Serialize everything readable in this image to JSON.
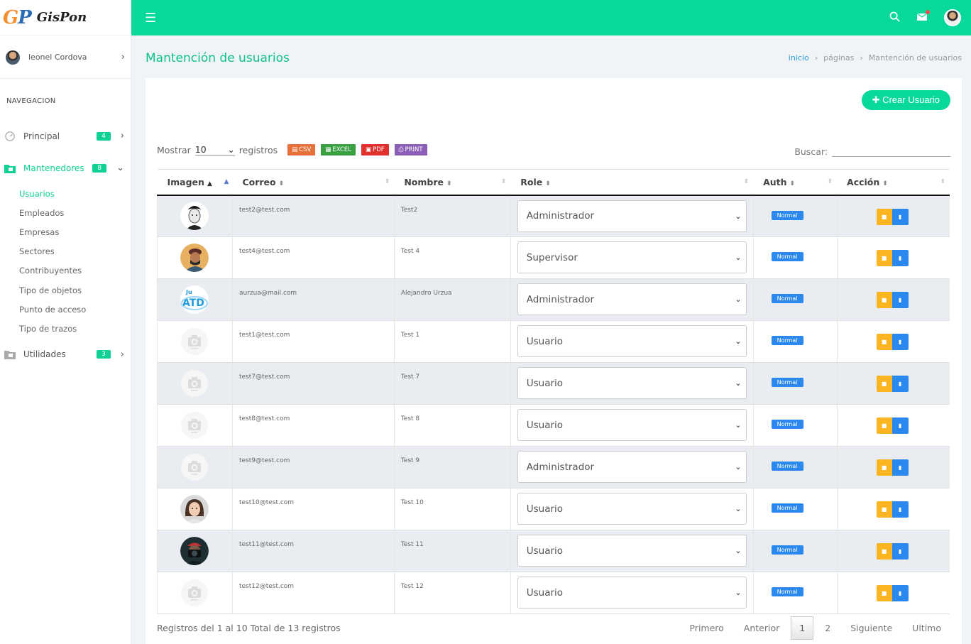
{
  "brand": {
    "logo_letters": "GP",
    "name": "GisPon"
  },
  "user": {
    "name": "leonel Cordova"
  },
  "nav": {
    "section_label": "NAVEGACION",
    "principal": {
      "label": "Principal",
      "badge": "4"
    },
    "mantenedores": {
      "label": "Mantenedores",
      "badge": "8"
    },
    "sub_items": [
      "Usuarios",
      "Empleados",
      "Empresas",
      "Sectores",
      "Contribuyentes",
      "Tipo de objetos",
      "Punto de acceso",
      "Tipo de trazos"
    ],
    "utilidades": {
      "label": "Utilidades",
      "badge": "3"
    }
  },
  "page": {
    "title": "Mantención de usuarios"
  },
  "breadcrumb": {
    "home": "inicio",
    "middle": "páginas",
    "current": "Mantención de usuarios"
  },
  "create_button": "Crear Usuario",
  "controls": {
    "show_label": "Mostrar",
    "show_value": "10",
    "records_label": "registros",
    "search_label": "Buscar:"
  },
  "export_buttons": [
    {
      "label": "CSV",
      "color": "#e8703a"
    },
    {
      "label": "EXCEL",
      "color": "#3aa142"
    },
    {
      "label": "PDF",
      "color": "#e0312e"
    },
    {
      "label": "PRINT",
      "color": "#8c5fb7"
    }
  ],
  "table": {
    "headers": [
      "Imagen",
      "Correo",
      "Nombre",
      "Role",
      "Auth",
      "Acción"
    ],
    "rows": [
      {
        "email": "test2@test.com",
        "name": "Test2",
        "role": "Administrador",
        "auth": "Normal",
        "avatar": "photo-bw"
      },
      {
        "email": "test4@test.com",
        "name": "Test 4",
        "role": "Supervisor",
        "auth": "Normal",
        "avatar": "photo-hat"
      },
      {
        "email": "aurzua@mail.com",
        "name": "Alejandro Urzua",
        "role": "Administrador",
        "auth": "Normal",
        "avatar": "logo"
      },
      {
        "email": "test1@test.com",
        "name": "Test 1",
        "role": "Usuario",
        "auth": "Normal",
        "avatar": "placeholder"
      },
      {
        "email": "test7@test.com",
        "name": "Test 7",
        "role": "Usuario",
        "auth": "Normal",
        "avatar": "placeholder"
      },
      {
        "email": "test8@test.com",
        "name": "Test 8",
        "role": "Usuario",
        "auth": "Normal",
        "avatar": "placeholder"
      },
      {
        "email": "test9@test.com",
        "name": "Test 9",
        "role": "Administrador",
        "auth": "Normal",
        "avatar": "placeholder"
      },
      {
        "email": "test10@test.com",
        "name": "Test 10",
        "role": "Usuario",
        "auth": "Normal",
        "avatar": "photo-woman"
      },
      {
        "email": "test11@test.com",
        "name": "Test 11",
        "role": "Usuario",
        "auth": "Normal",
        "avatar": "photo-camera"
      },
      {
        "email": "test12@test.com",
        "name": "Test 12",
        "role": "Usuario",
        "auth": "Normal",
        "avatar": "placeholder"
      }
    ]
  },
  "footer": {
    "info": "Registros del 1 al 10 Total de 13 registros"
  },
  "pagination": {
    "first": "Primero",
    "prev": "Anterior",
    "pages": [
      "1",
      "2"
    ],
    "current": "1",
    "next": "Siguiente",
    "last": "Ultimo"
  },
  "colors": {
    "accent": "#07d89b",
    "blue": "#2a88ef",
    "yellow": "#fbb521"
  }
}
